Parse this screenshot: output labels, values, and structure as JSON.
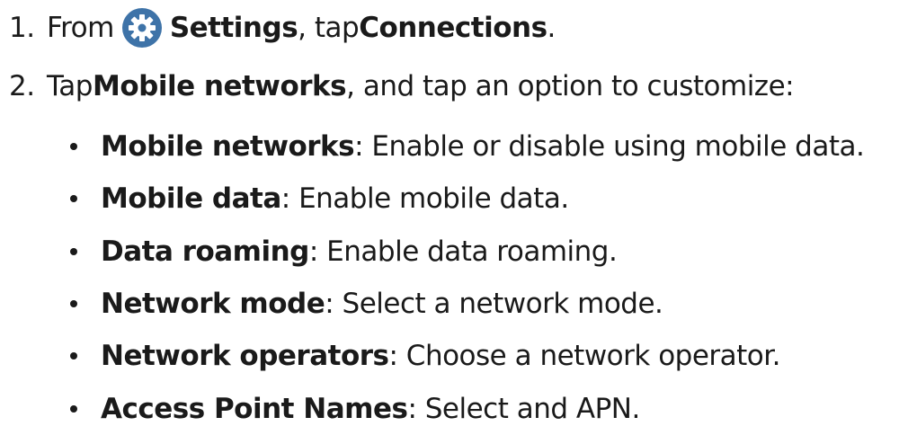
{
  "steps": [
    {
      "number": "1.",
      "parts": {
        "t1": "From",
        "b1": "Settings",
        "t2": ", tap ",
        "b2": "Connections",
        "t3": "."
      },
      "icon": "settings-gear-icon"
    },
    {
      "number": "2.",
      "parts": {
        "t1": "Tap ",
        "b1": "Mobile networks",
        "t2": ", and tap an option to customize:"
      }
    }
  ],
  "options": [
    {
      "name": "Mobile networks",
      "description": ": Enable or disable using mobile data."
    },
    {
      "name": "Mobile data",
      "description": ": Enable mobile data."
    },
    {
      "name": "Data roaming",
      "description": ": Enable data roaming."
    },
    {
      "name": "Network mode",
      "description": ": Select a network mode."
    },
    {
      "name": "Network operators",
      "description": ": Choose a network operator."
    },
    {
      "name": "Access Point Names",
      "description": ": Select and APN."
    }
  ],
  "colors": {
    "text": "#1a1a1a",
    "icon_background": "#3e73a8",
    "icon_foreground": "#ffffff"
  }
}
